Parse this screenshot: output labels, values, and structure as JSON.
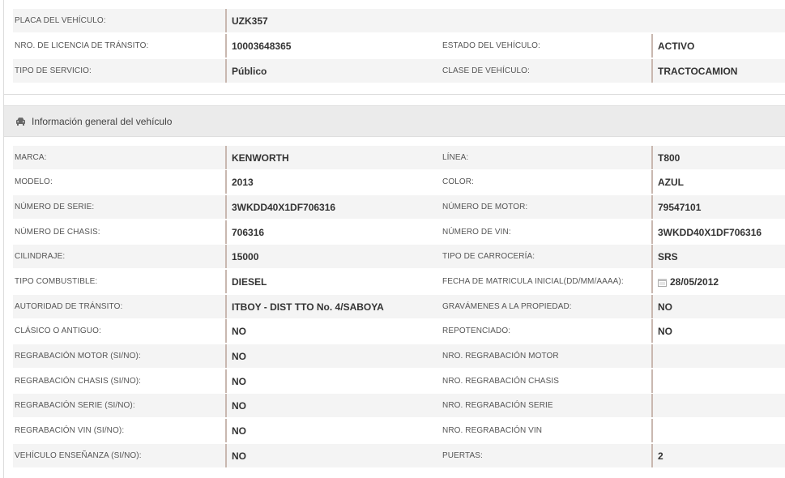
{
  "top_rows": [
    {
      "label1": "PLACA DEL VEHÍCULO:",
      "value1": "UZK357",
      "label2": "",
      "value2": ""
    },
    {
      "label1": "NRO. DE LICENCIA DE TRÁNSITO:",
      "value1": "10003648365",
      "label2": "ESTADO DEL VEHÍCULO:",
      "value2": "ACTIVO"
    },
    {
      "label1": "TIPO DE SERVICIO:",
      "value1": "Público",
      "label2": "CLASE DE VEHÍCULO:",
      "value2": "TRACTOCAMION"
    }
  ],
  "section": {
    "title": "Información general del vehículo",
    "icon": "car-icon"
  },
  "rows": [
    {
      "label1": "MARCA:",
      "value1": "KENWORTH",
      "label2": "LÍNEA:",
      "value2": "T800"
    },
    {
      "label1": "MODELO:",
      "value1": "2013",
      "label2": "COLOR:",
      "value2": "AZUL"
    },
    {
      "label1": "NÚMERO DE SERIE:",
      "value1": "3WKDD40X1DF706316",
      "label2": "NÚMERO DE MOTOR:",
      "value2": "79547101"
    },
    {
      "label1": "NÚMERO DE CHASIS:",
      "value1": "706316",
      "label2": "NÚMERO DE VIN:",
      "value2": "3WKDD40X1DF706316"
    },
    {
      "label1": "CILINDRAJE:",
      "value1": "15000",
      "label2": "TIPO DE CARROCERÍA:",
      "value2": "SRS"
    },
    {
      "label1": "TIPO COMBUSTIBLE:",
      "value1": "DIESEL",
      "label2": "FECHA DE MATRICULA INICIAL(DD/MM/AAAA):",
      "value2": "28/05/2012"
    },
    {
      "label1": "AUTORIDAD DE TRÁNSITO:",
      "value1": "ITBOY - DIST TTO No. 4/SABOYA",
      "label2": "GRAVÁMENES A LA PROPIEDAD:",
      "value2": "NO"
    },
    {
      "label1": "CLÁSICO O ANTIGUO:",
      "value1": "NO",
      "label2": "REPOTENCIADO:",
      "value2": "NO"
    },
    {
      "label1": "REGRABACIÓN MOTOR (SI/NO):",
      "value1": "NO",
      "label2": "NRO. REGRABACIÓN MOTOR",
      "value2": ""
    },
    {
      "label1": "REGRABACIÓN CHASIS (SI/NO):",
      "value1": "NO",
      "label2": "NRO. REGRABACIÓN CHASIS",
      "value2": ""
    },
    {
      "label1": "REGRABACIÓN SERIE (SI/NO):",
      "value1": "NO",
      "label2": "NRO. REGRABACIÓN SERIE",
      "value2": ""
    },
    {
      "label1": "REGRABACIÓN VIN (SI/NO):",
      "value1": "NO",
      "label2": "NRO. REGRABACIÓN VIN",
      "value2": ""
    },
    {
      "label1": "VEHÍCULO ENSEÑANZA (SI/NO):",
      "value1": "NO",
      "label2": "PUERTAS:",
      "value2": "2"
    }
  ]
}
